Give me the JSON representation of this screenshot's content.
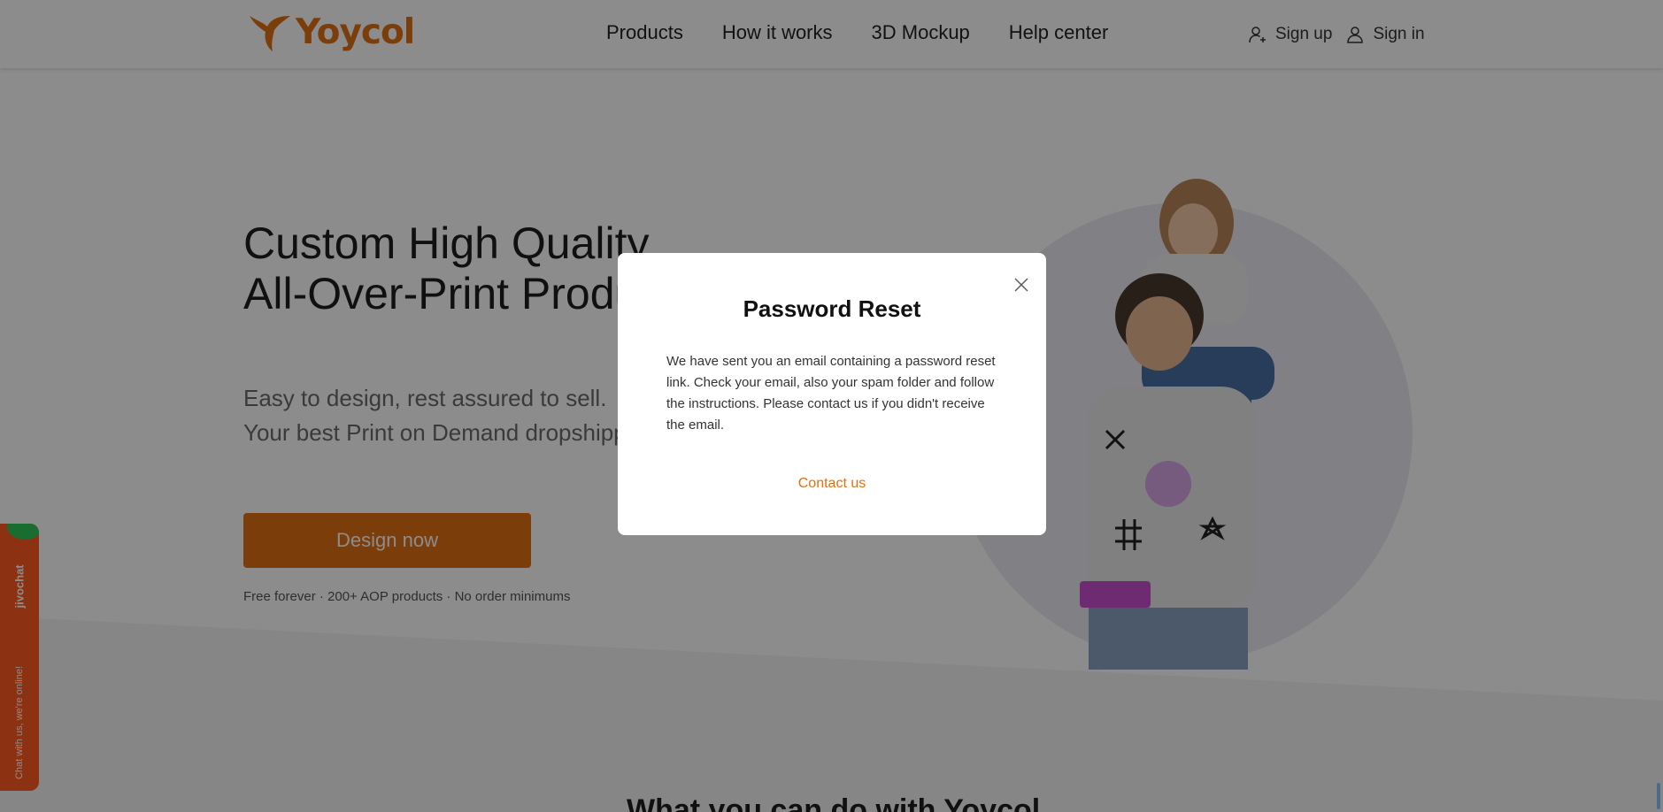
{
  "brand": {
    "name": "Yoycol",
    "color": "#e07013"
  },
  "nav": [
    {
      "label": "Products"
    },
    {
      "label": "How it works"
    },
    {
      "label": "3D Mockup"
    },
    {
      "label": "Help center"
    }
  ],
  "auth": {
    "sign_up": "Sign up",
    "sign_in": "Sign in"
  },
  "hero": {
    "title_line1": "Custom High Quality",
    "title_line2": "All-Over-Print Products",
    "sub_line1": "Easy to design, rest assured to sell.",
    "sub_line2": "Your best Print on Demand dropshipping partner",
    "cta": "Design now",
    "note": "Free forever · 200+ AOP products · No order minimums"
  },
  "section": {
    "heading": "What you can do with Yoycol"
  },
  "chat": {
    "brand": "jivochat",
    "tagline": "Chat with us, we're online!"
  },
  "modal": {
    "title": "Password Reset",
    "body": "We have sent you an email containing a password reset link. Check your email, also your spam folder and follow the instructions. Please contact us if you didn't receive the email.",
    "link": "Contact us"
  }
}
